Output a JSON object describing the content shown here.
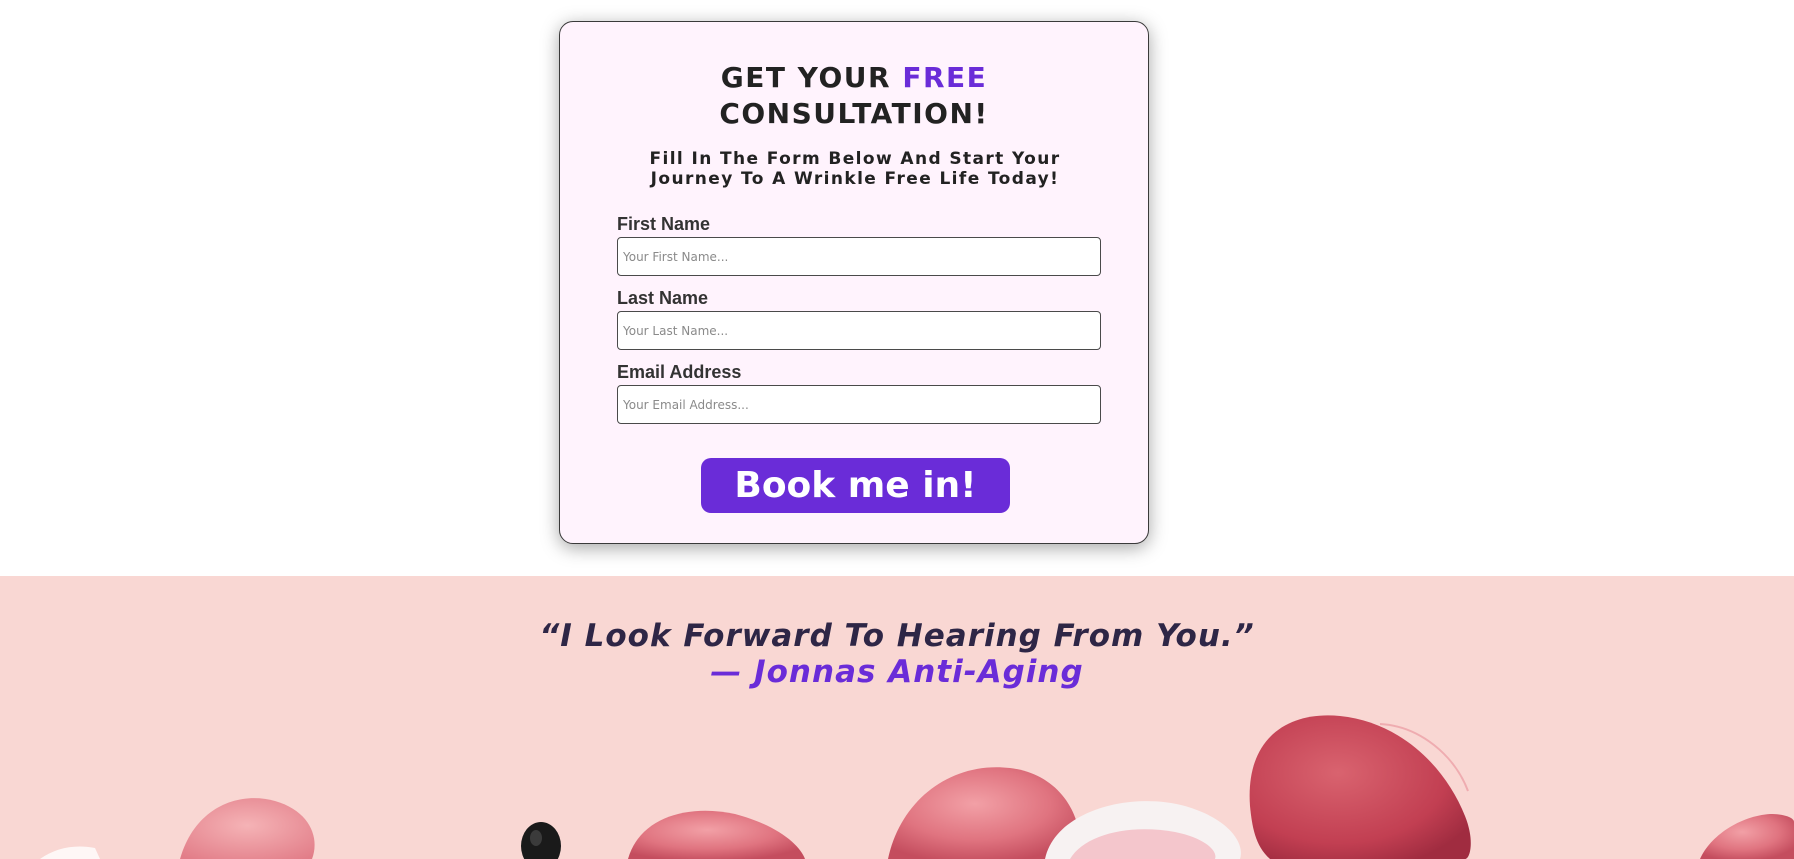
{
  "form": {
    "title_part1": "GET YOUR ",
    "title_accent": "FREE",
    "title_part2": "CONSULTATION!",
    "subtitle_line1": "Fill In The Form Below And Start Your",
    "subtitle_line2": "Journey To A Wrinkle Free Life Today!",
    "fields": [
      {
        "label": "First Name",
        "placeholder": "Your First Name...",
        "value": ""
      },
      {
        "label": "Last Name",
        "placeholder": "Your Last Name...",
        "value": ""
      },
      {
        "label": "Email Address",
        "placeholder": "Your Email Address...",
        "value": ""
      }
    ],
    "submit_label": "Book me in!"
  },
  "testimonial": {
    "quote": "“I Look Forward To Hearing From You.”",
    "author": "— Jonnas Anti-Aging"
  },
  "colors": {
    "accent": "#6a2cd8",
    "card_background": "#fff3fd",
    "section_background": "#f9d7d3",
    "heading_text": "#222222"
  }
}
